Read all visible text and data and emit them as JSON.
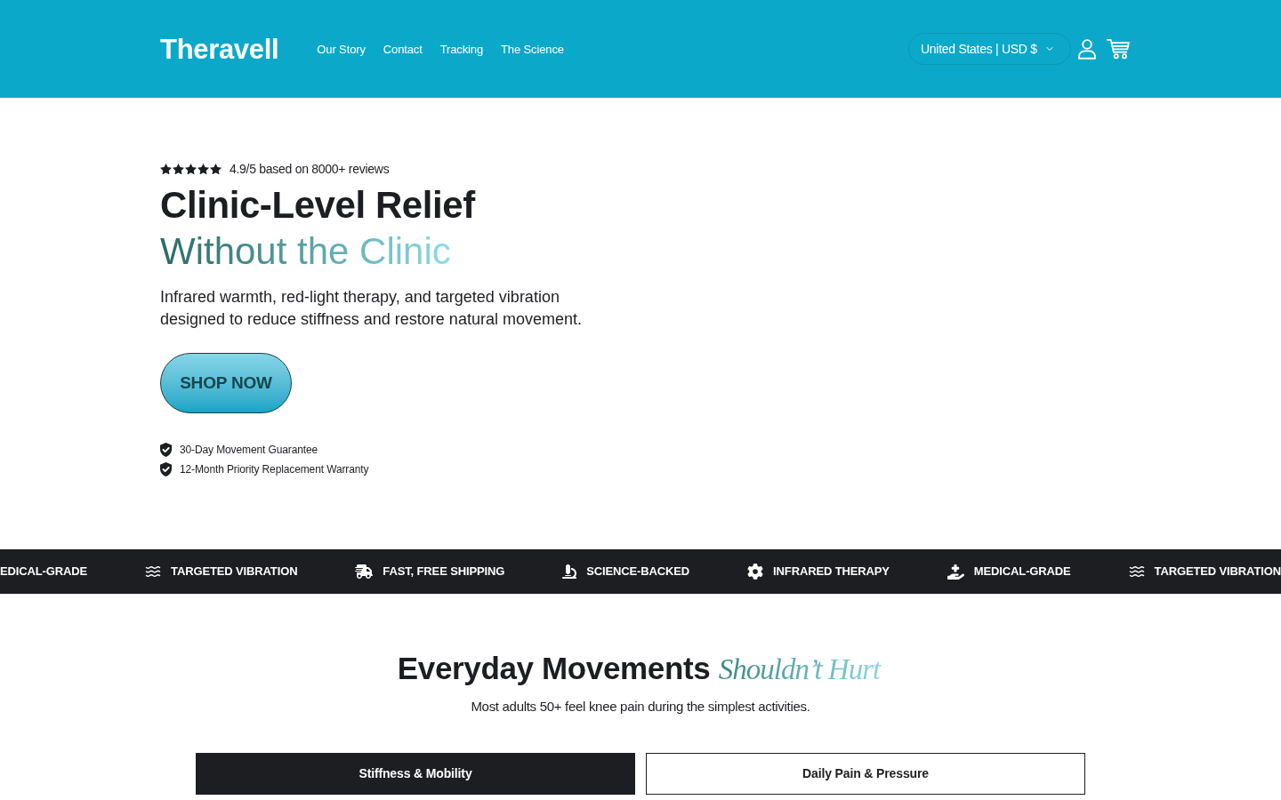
{
  "header": {
    "logo": "Theravell",
    "nav": [
      {
        "label": "Our Story"
      },
      {
        "label": "Contact"
      },
      {
        "label": "Tracking"
      },
      {
        "label": "The Science"
      }
    ],
    "locale_selector": {
      "label": "United States | USD $"
    }
  },
  "hero": {
    "rating": {
      "stars": 5,
      "text": "4.9/5 based on 8000+ reviews"
    },
    "title": "Clinic-Level Relief",
    "title_accent": "Without the Clinic",
    "description": "Infrared warmth, red-light therapy, and targeted vibration designed to reduce stiffness and restore natural movement.",
    "button": "SHOP NOW",
    "guarantees": [
      "30-Day Movement Guarantee",
      "12-Month Priority Replacement Warranty"
    ]
  },
  "features_bar": {
    "items": [
      {
        "kind": "plain",
        "label": "EDICAL-GRADE"
      },
      {
        "kind": "vibration",
        "label": "TARGETED VIBRATION"
      },
      {
        "kind": "shipping",
        "label": "FAST, FREE SHIPPING"
      },
      {
        "kind": "science",
        "label": "SCIENCE-BACKED"
      },
      {
        "kind": "infrared",
        "label": "INFRARED THERAPY"
      },
      {
        "kind": "medical",
        "label": "MEDICAL-GRADE"
      },
      {
        "kind": "vibration",
        "label": "TARGETED VIBRATION"
      }
    ]
  },
  "section": {
    "title": "Everyday Movements *Shouldn’t Hurt*",
    "subtitle": "Most adults 50+ feel knee pain during the simplest activities.",
    "tabs": [
      {
        "label": "Stiffness & Mobility",
        "selected": true
      },
      {
        "label": "Daily Pain & Pressure",
        "selected": false
      }
    ]
  }
}
